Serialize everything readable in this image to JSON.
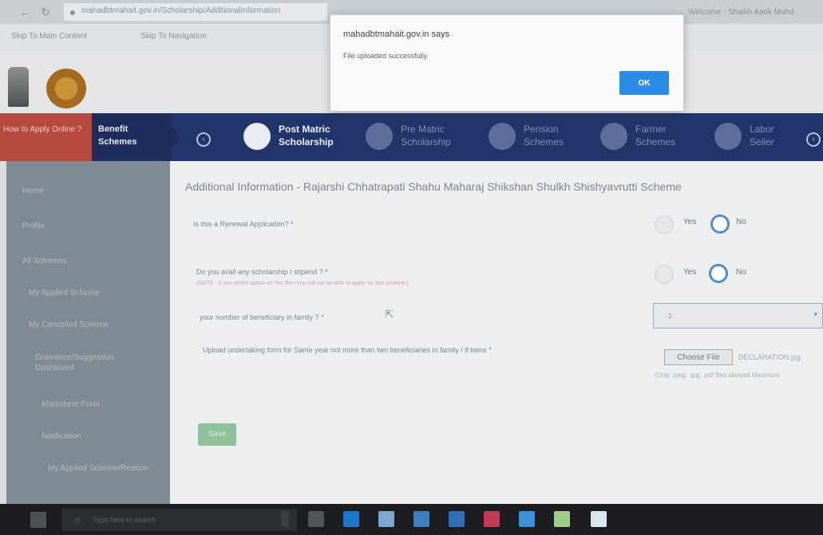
{
  "browser": {
    "url": "mahadbtmahait.gov.in/Scholarship/AdditionalInformation",
    "welcome": "Welcome : Shaikh Aatik Mohd"
  },
  "skip": {
    "main_content": "Skip To Main Content",
    "navigation": "Skip To Navigation"
  },
  "nav": {
    "apply_label": "How to Apply Online ?",
    "benefit_label": "Benefit Schemes",
    "items": [
      {
        "label": "Post Matric Scholarship"
      },
      {
        "label": "Pre Matric Scholarship"
      },
      {
        "label": "Pension Schemes"
      },
      {
        "label": "Farmer Schemes"
      },
      {
        "label": "Labor Seller"
      }
    ]
  },
  "sidebar": {
    "items": [
      "Home",
      "Profile",
      "All Schemes",
      "My Applied Scheme",
      "My Cancelled Scheme",
      "Grievance/Suggestion Dashboard",
      "Marksheet Form",
      "Notification",
      "My Applied Scheme/Reason"
    ]
  },
  "main": {
    "title": "Additional Information - Rajarshi Chhatrapati Shahu Maharaj Shikshan Shulkh Shishyavrutti Scheme",
    "q1": "Is this a Renewal Application? *",
    "q2": "Do you avail any scholarship / stipend ? *",
    "q2_note": "(NOTE : If you select option as Yes then you will not be able to apply for this scheme.)",
    "q3": "your number of beneficiary in family ? *",
    "q4": "Upload undertaking form for Same year not more than two beneficiaries in family / if twins *",
    "yes": "Yes",
    "no": "No",
    "select_value": "1",
    "file_button": "Choose File",
    "file_name": "DECLARATION.jpg",
    "file_hint": "(Only .jpeg, .jpg, .pdf files allowed Maximum",
    "save": "Save"
  },
  "dialog": {
    "title": "mahadbtmahait.gov.in says",
    "message": "File uploaded successfully.",
    "ok": "OK"
  },
  "taskbar": {
    "search_placeholder": "Type here to search"
  }
}
